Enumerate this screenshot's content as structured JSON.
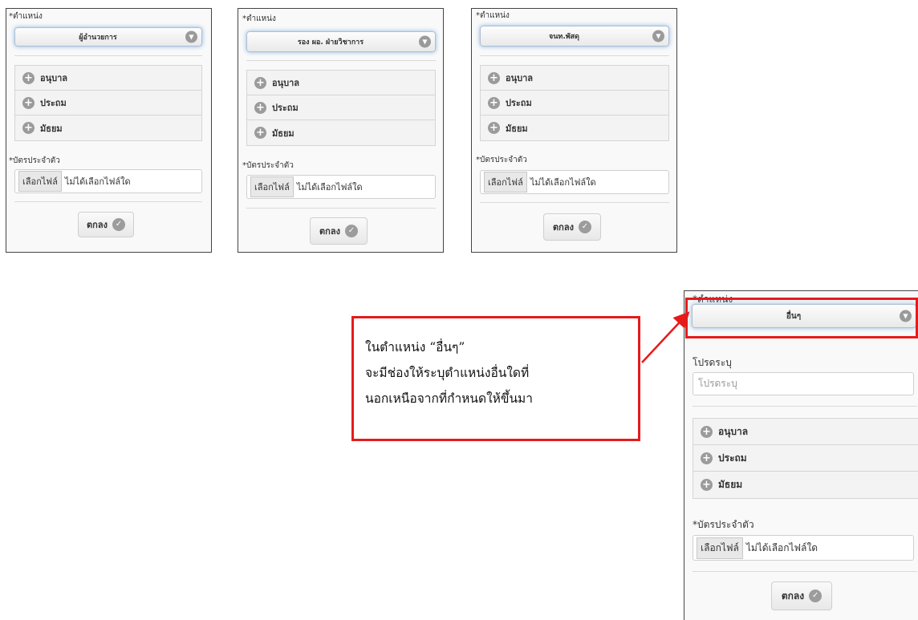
{
  "panels": [
    {
      "position_label": "*ตำแหน่ง",
      "position_value": "ผู้อำนวยการ",
      "levels": [
        "อนุบาล",
        "ประถม",
        "มัธยม"
      ],
      "id_card_label": "*บัตรประจำตัว",
      "file_button": "เลือกไฟล์",
      "file_status": "ไม่ได้เลือกไฟล์ใด",
      "ok_label": "ตกลง"
    },
    {
      "position_label": "*ตำแหน่ง",
      "position_value": "รอง ผอ. ฝ่ายวิชาการ",
      "levels": [
        "อนุบาล",
        "ประถม",
        "มัธยม"
      ],
      "id_card_label": "*บัตรประจำตัว",
      "file_button": "เลือกไฟล์",
      "file_status": "ไม่ได้เลือกไฟล์ใด",
      "ok_label": "ตกลง"
    },
    {
      "position_label": "*ตำแหน่ง",
      "position_value": "จนท.พัสดุ",
      "levels": [
        "อนุบาล",
        "ประถม",
        "มัธยม"
      ],
      "id_card_label": "*บัตรประจำตัว",
      "file_button": "เลือกไฟล์",
      "file_status": "ไม่ได้เลือกไฟล์ใด",
      "ok_label": "ตกลง"
    },
    {
      "position_label": "*ตำแหน่ง",
      "position_value": "อื่นๆ",
      "specify_label": "โปรดระบุ",
      "specify_placeholder": "โปรดระบุ",
      "levels": [
        "อนุบาล",
        "ประถม",
        "มัธยม"
      ],
      "id_card_label": "*บัตรประจำตัว",
      "file_button": "เลือกไฟล์",
      "file_status": "ไม่ได้เลือกไฟล์ใด",
      "ok_label": "ตกลง"
    }
  ],
  "callout": {
    "lines": [
      "ในตำแหน่ง “อื่นๆ”",
      "จะมีช่องให้ระบุตำแหน่งอื่นใดที่",
      "นอกเหนือจากที่กำหนดให้ขึ้นมา"
    ]
  },
  "colors": {
    "highlight": "#e51b1b",
    "select_glow": "#8fb6e0",
    "icon_gray": "#9b9b9b"
  },
  "icons": {
    "select_arrow": "chevron-down-icon",
    "accordion": "plus-circle-icon",
    "ok": "check-circle-icon"
  }
}
